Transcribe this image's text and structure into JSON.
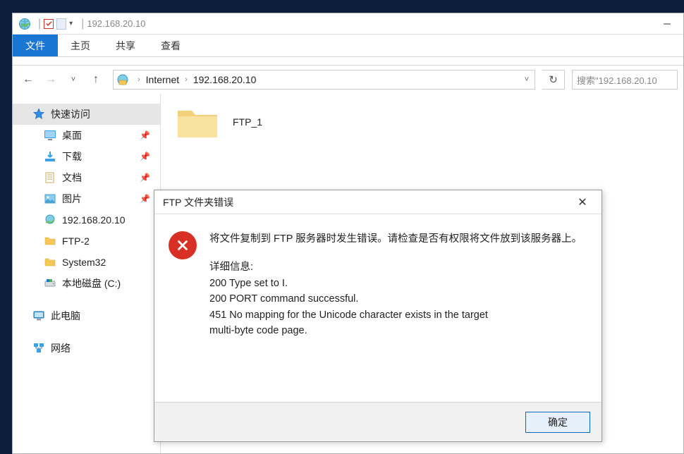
{
  "titlebar": {
    "address": "192.168.20.10"
  },
  "ribbon": {
    "file": "文件",
    "home": "主页",
    "share": "共享",
    "view": "查看"
  },
  "breadcrumb": {
    "seg1": "Internet",
    "seg2": "192.168.20.10"
  },
  "search": {
    "placeholder": "搜索\"192.168.20.10"
  },
  "sidebar": {
    "quick_access": "快速访问",
    "desktop": "桌面",
    "downloads": "下载",
    "documents": "文档",
    "pictures": "图片",
    "ftp_server": "192.168.20.10",
    "ftp2": "FTP-2",
    "system32": "System32",
    "local_disk": "本地磁盘 (C:)",
    "this_pc": "此电脑",
    "network": "网络"
  },
  "content": {
    "folder1": "FTP_1"
  },
  "dialog": {
    "title": "FTP 文件夹错误",
    "main_message": "将文件复制到 FTP 服务器时发生错误。请检查是否有权限将文件放到该服务器上。",
    "details_label": "详细信息:",
    "line1": "200 Type set to I.",
    "line2": "200 PORT command successful.",
    "line3": "451 No mapping for the Unicode character exists in the target",
    "line4": "multi-byte code page.",
    "ok": "确定"
  }
}
